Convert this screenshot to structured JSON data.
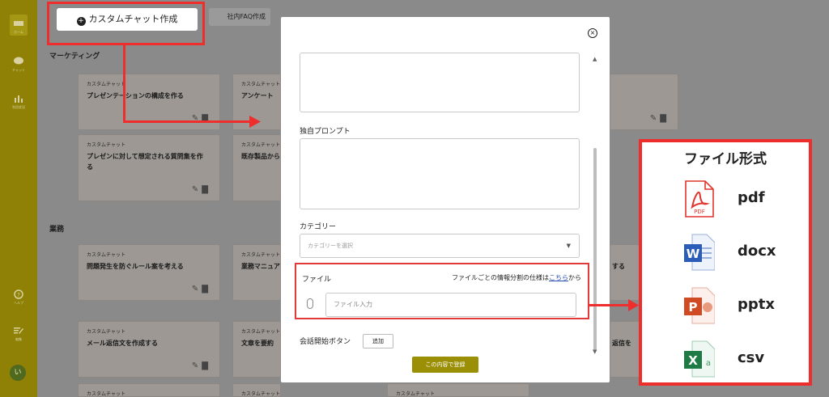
{
  "sidebar": {
    "items": [
      {
        "label": "ホーム"
      },
      {
        "label": "チャット"
      },
      {
        "label": "利用状況"
      },
      {
        "label": "ヘルプ"
      },
      {
        "label": "編集"
      }
    ],
    "avatar": "い"
  },
  "toolbar": {
    "create_label": "カスタムチャット作成",
    "faq_label": "社内FAQ作成"
  },
  "sections": {
    "marketing": "マーケティング",
    "business": "業務"
  },
  "cards": [
    {
      "tag": "カスタムチャット",
      "title": "プレゼンテーションの構成を作る"
    },
    {
      "tag": "カスタムチャット",
      "title": "アンケート"
    },
    {
      "tag": "カスタムチャット",
      "title": "プレゼンに対して想定される質問集を作る"
    },
    {
      "tag": "カスタムチャット",
      "title": "既存製品から"
    },
    {
      "tag": "カスタムチャット",
      "title": "問題発生を防ぐルール案を考える"
    },
    {
      "tag": "カスタムチャット",
      "title": "業務マニュア"
    },
    {
      "tag": "カスタムチャット",
      "title": "メール返信文を作成する"
    },
    {
      "tag": "カスタムチャット",
      "title": "文章を要約"
    },
    {
      "tag": "カスタムチャット",
      "title": ""
    },
    {
      "tag": "カスタムチャット",
      "title": ""
    },
    {
      "tag": "カスタムチャット",
      "title": ""
    },
    {
      "tag": "",
      "title": "する"
    },
    {
      "tag": "",
      "title": "返信を"
    }
  ],
  "modal": {
    "close": "×",
    "prompt_label": "独自プロンプト",
    "category_label": "カテゴリー",
    "category_placeholder": "カテゴリーを選択",
    "file_label": "ファイル",
    "file_note_prefix": "ファイルごとの情報分割の仕様は",
    "file_note_link": "こちら",
    "file_note_suffix": "から",
    "file_input_placeholder": "ファイル入力",
    "start_button_label": "会話開始ボタン",
    "add_label": "追加",
    "submit_label": "この内容で登録"
  },
  "formats": {
    "title": "ファイル形式",
    "items": [
      {
        "name": "pdf",
        "icon": "pdf-icon",
        "color": "#e0342c",
        "sub": "PDF"
      },
      {
        "name": "docx",
        "icon": "word-icon",
        "color": "#2b5cb8",
        "sub": "W"
      },
      {
        "name": "pptx",
        "icon": "powerpoint-icon",
        "color": "#d04a23",
        "sub": "P"
      },
      {
        "name": "csv",
        "icon": "excel-icon",
        "color": "#1f7a45",
        "sub": "X"
      }
    ]
  },
  "colors": {
    "accent": "#ee2d2d",
    "brand": "#9b8f06"
  }
}
